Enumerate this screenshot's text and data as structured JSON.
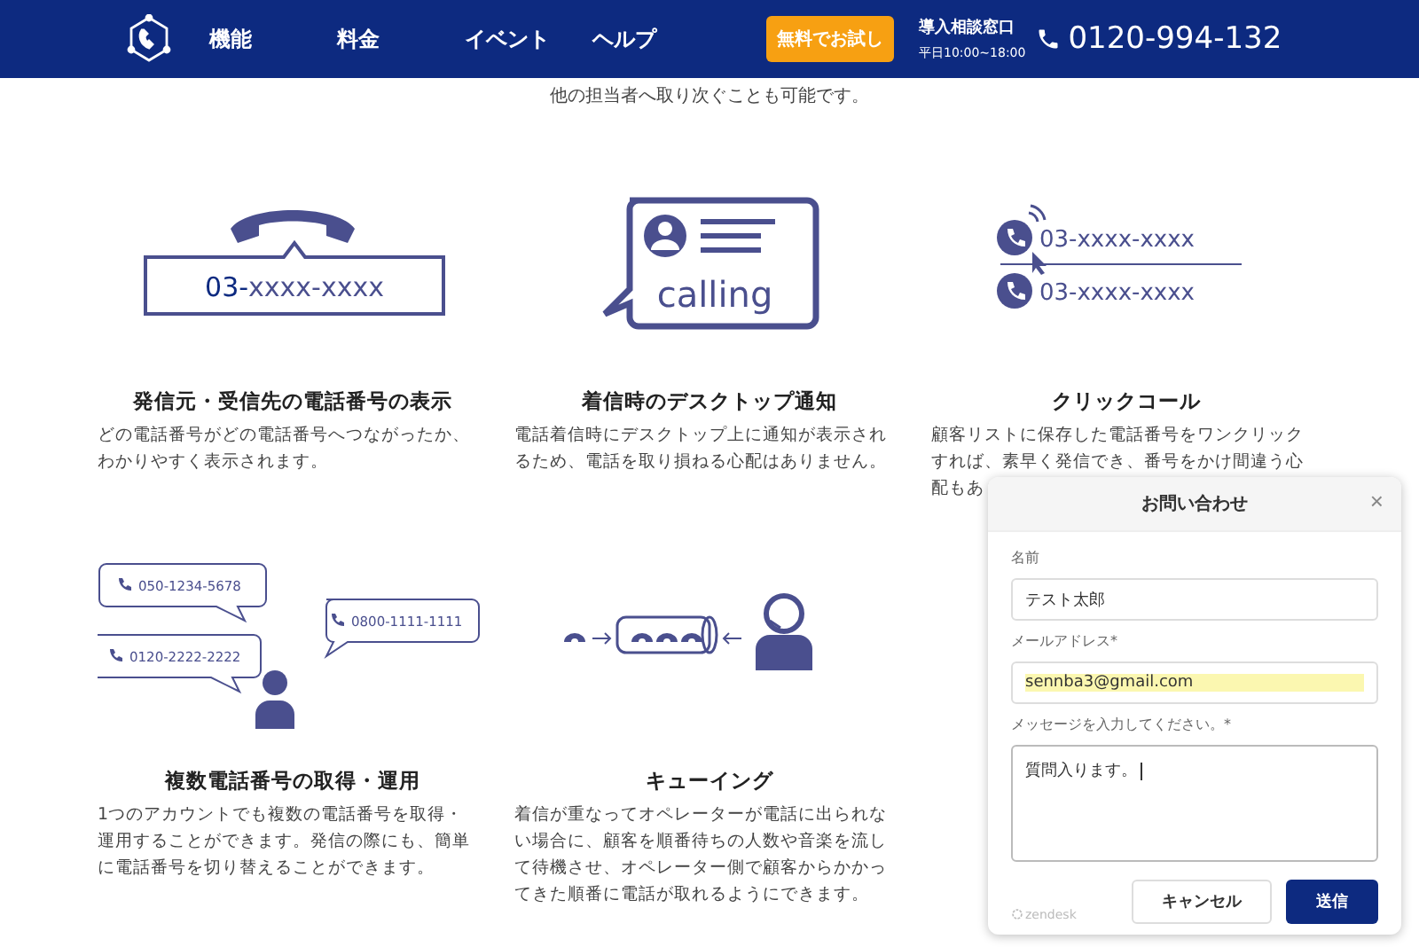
{
  "header": {
    "nav": [
      "機能",
      "料金",
      "イベント",
      "ヘルプ"
    ],
    "trial_button": "無料でお試し",
    "contact_title": "導入相談窓口",
    "contact_hours": "平日10:00~18:00",
    "phone": "0120-994-132"
  },
  "intro": "他の担当者へ取り次ぐことも可能です。",
  "features": [
    {
      "title": "発信元・受信先の電話番号の表示",
      "description": "どの電話番号がどの電話番号へつながったか、わかりやすく表示されます。",
      "illustration": {
        "kind": "caller-id",
        "labels": [
          "03-",
          "xxxx-xxxx"
        ]
      }
    },
    {
      "title": "着信時のデスクトップ通知",
      "description": "電話着信時にデスクトップ上に通知が表示されるため、電話を取り損ねる心配はありません。",
      "illustration": {
        "kind": "notification",
        "labels": [
          "calling"
        ]
      }
    },
    {
      "title": "クリックコール",
      "description": "顧客リストに保存した電話番号をワンクリックすれば、素早く発信でき、番号をかけ間違う心配もあ",
      "illustration": {
        "kind": "click-call",
        "labels": [
          "03-xxxx-xxxx",
          "03-xxxx-xxxx"
        ]
      }
    },
    {
      "title": "複数電話番号の取得・運用",
      "description": "1つのアカウントでも複数の電話番号を取得・運用することができます。発信の際にも、簡単に電話番号を切り替えることができます。",
      "illustration": {
        "kind": "multi-number",
        "labels": [
          "050-1234-5678",
          "0800-1111-1111",
          "0120-2222-2222"
        ]
      }
    },
    {
      "title": "キューイング",
      "description": "着信が重なってオペレーターが電話に出られない場合に、顧客を順番待ちの人数や音楽を流して待機させ、オペレーター側で顧客からかかってきた順番に電話が取れるようにできます。",
      "illustration": {
        "kind": "queue"
      }
    }
  ],
  "contact_widget": {
    "title": "お問い合わせ",
    "close": "×",
    "fields": [
      {
        "label": "名前",
        "value": "テスト太郎",
        "kind": "input",
        "highlighted": false
      },
      {
        "label": "メールアドレス*",
        "value": "sennba3@gmail.com",
        "kind": "input",
        "highlighted": true
      },
      {
        "label": "メッセージを入力してください。*",
        "value": "質問入ります。",
        "kind": "textarea",
        "highlighted": false
      }
    ],
    "brand": "zendesk",
    "cancel_button": "キャンセル",
    "submit_button": "送信"
  }
}
